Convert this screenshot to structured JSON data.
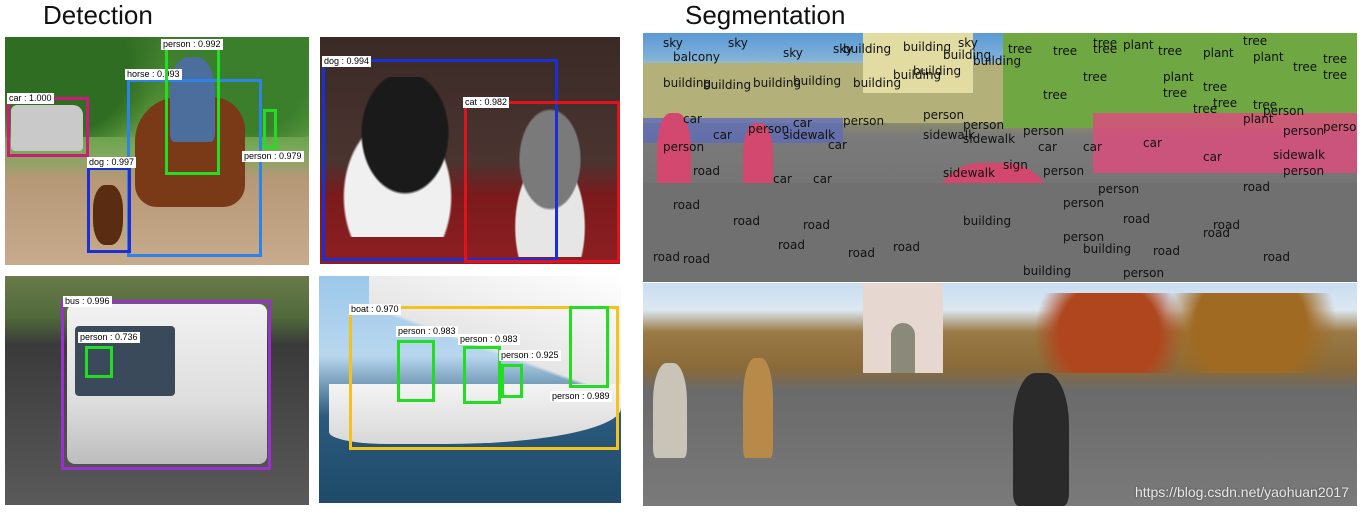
{
  "headings": {
    "detection": "Detection",
    "segmentation": "Segmentation"
  },
  "detection": {
    "panel1": {
      "labels": {
        "person_top": "person : 0.992",
        "horse": "horse : 0.993",
        "car": "car : 1.000",
        "dog": "dog : 0.997",
        "person_right": "person : 0.979"
      }
    },
    "panel2": {
      "labels": {
        "dog": "dog : 0.994",
        "cat": "cat : 0.982"
      }
    },
    "panel3": {
      "labels": {
        "bus": "bus : 0.996",
        "person": "person : 0.736"
      }
    },
    "panel4": {
      "labels": {
        "boat": "boat : 0.970",
        "person1": "person : 0.983",
        "person2": "person : 0.983",
        "person3": "person : 0.925",
        "person4": "person : 0.989"
      }
    },
    "colors": {
      "magenta": "#d0197a",
      "green": "#22dd22",
      "blue": "#2b84e6",
      "darkblue": "#1b2fd6",
      "red": "#e0121c",
      "purple": "#9b2fd0",
      "yellow": "#f4c21a"
    }
  },
  "segmentation": {
    "labels": [
      "sky",
      "sky",
      "sky",
      "sky",
      "sky",
      "balcony",
      "building",
      "building",
      "building",
      "building",
      "building",
      "tree",
      "tree",
      "tree",
      "tree",
      "tree",
      "plant",
      "plant",
      "plant",
      "plant",
      "tree",
      "tree",
      "tree",
      "tree",
      "building",
      "building",
      "building",
      "building",
      "building",
      "building",
      "tree",
      "tree",
      "tree",
      "tree",
      "car",
      "car",
      "car",
      "car",
      "car",
      "car",
      "car",
      "car",
      "car",
      "car",
      "person",
      "person",
      "person",
      "person",
      "person",
      "person",
      "person",
      "person",
      "person",
      "person",
      "person",
      "person",
      "road",
      "road",
      "road",
      "road",
      "road",
      "road",
      "road",
      "road",
      "road",
      "road",
      "sidewalk",
      "sidewalk",
      "sidewalk",
      "sign",
      "sidewalk",
      "building",
      "building",
      "building",
      "person",
      "person",
      "person",
      "road",
      "road",
      "road",
      "road",
      "road",
      "tree",
      "tree",
      "tree",
      "plant",
      "sidewalk"
    ],
    "watermark": "https://blog.csdn.net/yaohuan2017"
  }
}
